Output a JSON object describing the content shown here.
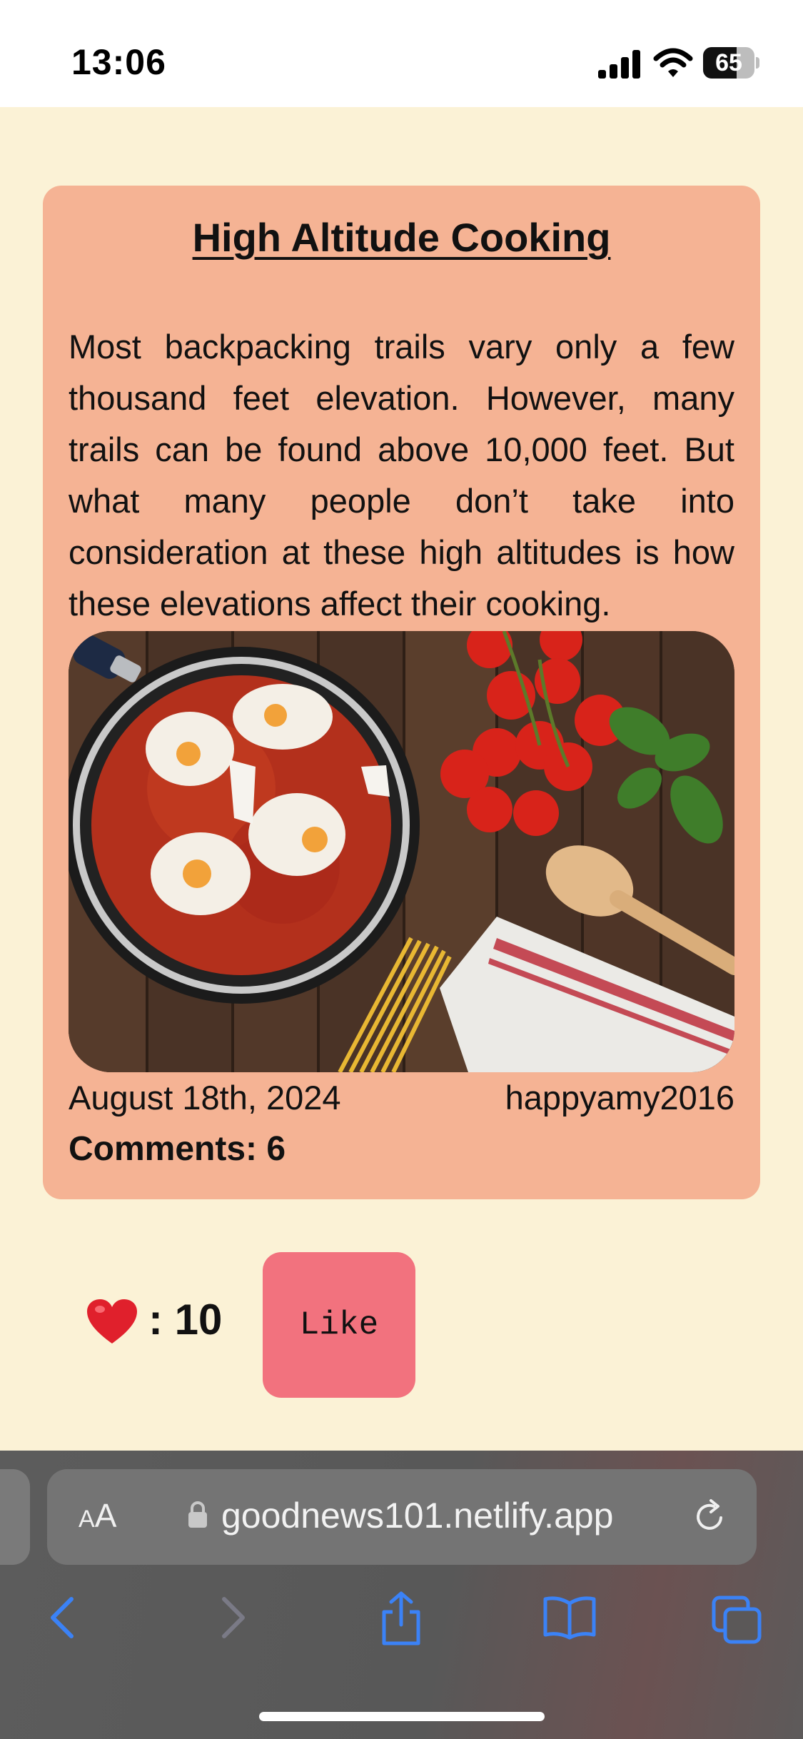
{
  "status_bar": {
    "time": "13:06",
    "battery": "65",
    "battery_level": 0.65,
    "icons": [
      "signal-icon",
      "wifi-icon",
      "battery-icon"
    ]
  },
  "post": {
    "title": "High Altitude Cooking",
    "body": "Most backpacking trails vary only a few thousand feet elevation. However, many trails can be found above 10,000 feet. But what many people don’t take into consideration at these high altitudes is how these elevations affect their cooking.",
    "date": "August 18th, 2024",
    "author": "happyamy2016",
    "comments": "Comments: 6"
  },
  "likes": {
    "icon": "heart-icon",
    "count": ": 10",
    "button_label": "Like"
  },
  "browser": {
    "aa_small": "A",
    "aa_big": "A",
    "url": "goodnews101.netlify.app",
    "icons": [
      "lock-icon",
      "reload-icon",
      "back-icon",
      "forward-icon",
      "share-icon",
      "bookmarks-icon",
      "tabs-icon"
    ]
  },
  "colors": {
    "page_background": "#fbf2d6",
    "card_background": "#f5b394",
    "like_button": "#f2727e",
    "browser_accent": "#3b82f6"
  }
}
